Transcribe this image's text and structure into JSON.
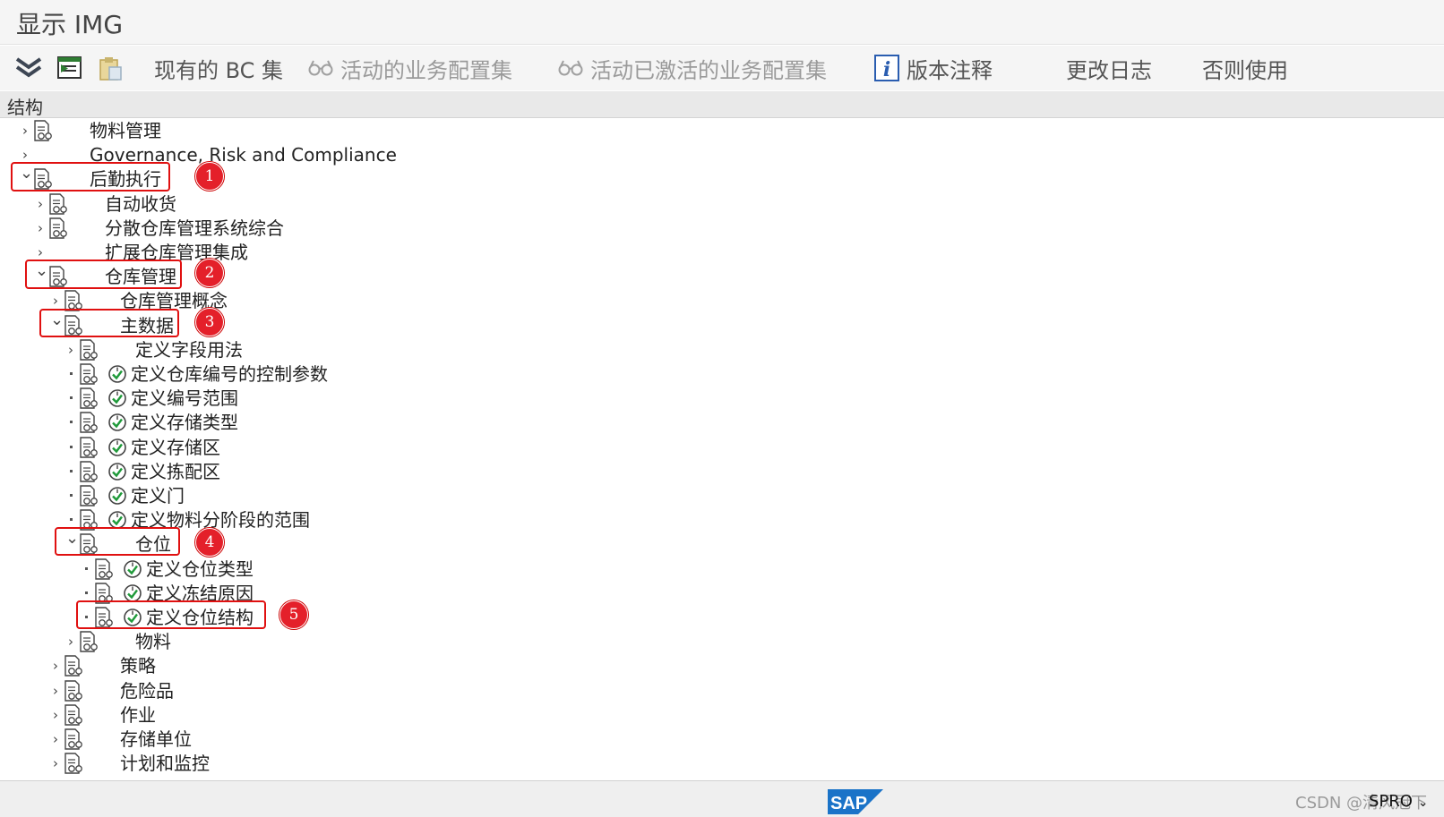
{
  "window": {
    "title": "显示 IMG"
  },
  "toolbar": {
    "existing_bc_sets": "现有的 BC 集",
    "active_bc_sets": "活动的业务配置集",
    "activated_bc_sets": "活动已激活的业务配置集",
    "release_notes": "版本注释",
    "change_log": "更改日志",
    "where_used": "否则使用"
  },
  "structure": {
    "header": "结构",
    "nodes": [
      {
        "label": "物料管理",
        "level": 0,
        "expander": "collapsed",
        "doc": true,
        "activity": false
      },
      {
        "label": "Governance, Risk and Compliance",
        "level": 0,
        "expander": "collapsed",
        "doc": false,
        "activity": false
      },
      {
        "label": "后勤执行",
        "level": 0,
        "expander": "expanded",
        "doc": true,
        "activity": false
      },
      {
        "label": "自动收货",
        "level": 1,
        "expander": "collapsed",
        "doc": true,
        "activity": false
      },
      {
        "label": "分散仓库管理系统综合",
        "level": 1,
        "expander": "collapsed",
        "doc": true,
        "activity": false
      },
      {
        "label": "扩展仓库管理集成",
        "level": 1,
        "expander": "collapsed",
        "doc": false,
        "activity": false
      },
      {
        "label": "仓库管理",
        "level": 1,
        "expander": "expanded",
        "doc": true,
        "activity": false
      },
      {
        "label": "仓库管理概念",
        "level": 2,
        "expander": "collapsed",
        "doc": true,
        "activity": false
      },
      {
        "label": "主数据",
        "level": 2,
        "expander": "expanded",
        "doc": true,
        "activity": false
      },
      {
        "label": "定义字段用法",
        "level": 3,
        "expander": "collapsed",
        "doc": true,
        "activity": false
      },
      {
        "label": "定义仓库编号的控制参数",
        "level": 3,
        "expander": "leaf",
        "doc": true,
        "activity": true
      },
      {
        "label": "定义编号范围",
        "level": 3,
        "expander": "leaf",
        "doc": true,
        "activity": true
      },
      {
        "label": "定义存储类型",
        "level": 3,
        "expander": "leaf",
        "doc": true,
        "activity": true
      },
      {
        "label": "定义存储区",
        "level": 3,
        "expander": "leaf",
        "doc": true,
        "activity": true
      },
      {
        "label": "定义拣配区",
        "level": 3,
        "expander": "leaf",
        "doc": true,
        "activity": true
      },
      {
        "label": "定义门",
        "level": 3,
        "expander": "leaf",
        "doc": true,
        "activity": true
      },
      {
        "label": "定义物料分阶段的范围",
        "level": 3,
        "expander": "leaf",
        "doc": true,
        "activity": true
      },
      {
        "label": "仓位",
        "level": 3,
        "expander": "expanded",
        "doc": true,
        "activity": false
      },
      {
        "label": "定义仓位类型",
        "level": 4,
        "expander": "leaf",
        "doc": true,
        "activity": true
      },
      {
        "label": "定义冻结原因",
        "level": 4,
        "expander": "leaf",
        "doc": true,
        "activity": true
      },
      {
        "label": "定义仓位结构",
        "level": 4,
        "expander": "leaf",
        "doc": true,
        "activity": true
      },
      {
        "label": "物料",
        "level": 3,
        "expander": "collapsed",
        "doc": true,
        "activity": false
      },
      {
        "label": "策略",
        "level": 2,
        "expander": "collapsed",
        "doc": true,
        "activity": false
      },
      {
        "label": "危险品",
        "level": 2,
        "expander": "collapsed",
        "doc": true,
        "activity": false
      },
      {
        "label": "作业",
        "level": 2,
        "expander": "collapsed",
        "doc": true,
        "activity": false
      },
      {
        "label": "存储单位",
        "level": 2,
        "expander": "collapsed",
        "doc": true,
        "activity": false
      },
      {
        "label": "计划和监控",
        "level": 2,
        "expander": "collapsed",
        "doc": true,
        "activity": false
      }
    ]
  },
  "annotations": [
    "1",
    "2",
    "3",
    "4",
    "5"
  ],
  "statusbar": {
    "logo_text": "SAP",
    "watermark": "CSDN @清风冠下",
    "transaction": "SPRO"
  },
  "colors": {
    "highlight": "#e01010",
    "badge": "#e4202a",
    "activity_check": "#1f9a3a",
    "sap_blue": "#1a73c8"
  }
}
